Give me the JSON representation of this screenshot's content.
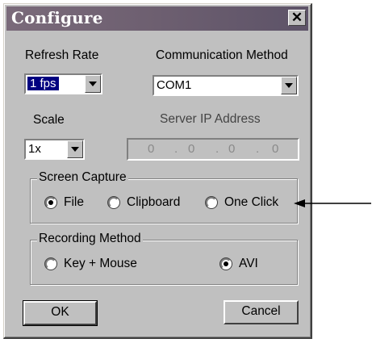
{
  "window": {
    "title": "Configure"
  },
  "refresh_rate": {
    "label": "Refresh Rate",
    "value": "1 fps"
  },
  "communication": {
    "label": "Communication Method",
    "value": "COM1"
  },
  "scale": {
    "label": "Scale",
    "value": "1x"
  },
  "server_ip": {
    "label": "Server IP Address",
    "octets": [
      "0",
      "0",
      "0",
      "0"
    ],
    "dot": "."
  },
  "screen_capture": {
    "title": "Screen Capture",
    "options": [
      {
        "label": "File",
        "selected": true
      },
      {
        "label": "Clipboard",
        "selected": false
      },
      {
        "label": "One Click",
        "selected": false
      }
    ]
  },
  "recording": {
    "title": "Recording Method",
    "options": [
      {
        "label": "Key + Mouse",
        "selected": false
      },
      {
        "label": "AVI",
        "selected": true
      }
    ]
  },
  "buttons": {
    "ok": "OK",
    "cancel": "Cancel"
  },
  "colors": {
    "dialog_bg": "#c0c0c0",
    "title_bar": "#6d5f70",
    "selection": "#000080"
  }
}
